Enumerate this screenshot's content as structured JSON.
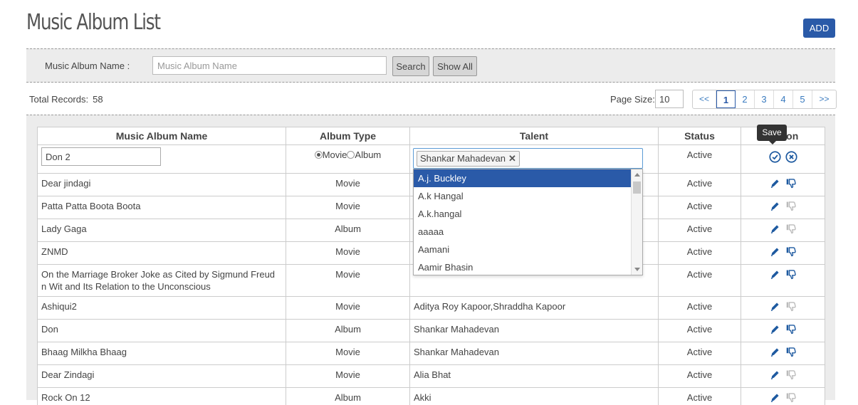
{
  "page": {
    "title": "Music Album List",
    "add_label": "ADD"
  },
  "search": {
    "label": "Music Album Name :",
    "placeholder": "Music Album Name",
    "search_label": "Search",
    "show_all_label": "Show All"
  },
  "summary": {
    "total_label": "Total Records:",
    "total_value": "58",
    "page_size_label": "Page Size:",
    "page_size_value": "10"
  },
  "pagination": {
    "first": "<<",
    "pages": [
      "1",
      "2",
      "3",
      "4",
      "5"
    ],
    "last": ">>",
    "current": "1"
  },
  "table": {
    "headers": [
      "Music Album Name",
      "Album Type",
      "Talent",
      "Status",
      "Action"
    ],
    "edit_row": {
      "name_value": "Don 2",
      "type_options": [
        "Movie",
        "Album"
      ],
      "type_selected": "Movie",
      "talent_chip": "Shankar Mahadevan",
      "talent_remove": "✕",
      "status": "Active"
    },
    "rows": [
      {
        "name": "Dear jindagi",
        "type": "Movie",
        "talent": "",
        "status": "Active",
        "like_active": true
      },
      {
        "name": "Patta Patta Boota Boota",
        "type": "Movie",
        "talent": "",
        "status": "Active",
        "like_active": false
      },
      {
        "name": "Lady Gaga",
        "type": "Album",
        "talent": "",
        "status": "Active",
        "like_active": false
      },
      {
        "name": "ZNMD",
        "type": "Movie",
        "talent": "",
        "status": "Active",
        "like_active": true
      },
      {
        "name": "On the Marriage Broker Joke as Cited by Sigmund Freud n Wit and Its Relation to the Unconscious",
        "type": "Movie",
        "talent": "",
        "status": "Active",
        "like_active": true
      },
      {
        "name": "Ashiqui2",
        "type": "Movie",
        "talent": "Aditya Roy Kapoor,Shraddha Kapoor",
        "status": "Active",
        "like_active": false
      },
      {
        "name": "Don",
        "type": "Album",
        "talent": "Shankar Mahadevan",
        "status": "Active",
        "like_active": true
      },
      {
        "name": "Bhaag Milkha Bhaag",
        "type": "Movie",
        "talent": "Shankar Mahadevan",
        "status": "Active",
        "like_active": true
      },
      {
        "name": "Dear Zindagi",
        "type": "Movie",
        "talent": "Alia Bhat",
        "status": "Active",
        "like_active": false
      },
      {
        "name": "Rock On 12",
        "type": "Album",
        "talent": "Akki",
        "status": "Active",
        "like_active": false
      }
    ]
  },
  "dropdown": {
    "options": [
      "A.j. Buckley",
      "A.k Hangal",
      "A.k.hangal",
      "aaaaa",
      "Aamani",
      "Aamir Bhasin"
    ],
    "highlighted": "A.j. Buckley"
  },
  "tooltip": {
    "text": "Save"
  },
  "icons": {
    "save": "check-circle-icon",
    "cancel": "x-circle-icon",
    "edit": "pencil-icon",
    "toggle": "thumbs-down-icon"
  },
  "colors": {
    "accent": "#2a5aa8",
    "icon_blue": "#1e5aa0",
    "icon_gray": "#bbbbbb",
    "panel_bg": "#ececec"
  }
}
